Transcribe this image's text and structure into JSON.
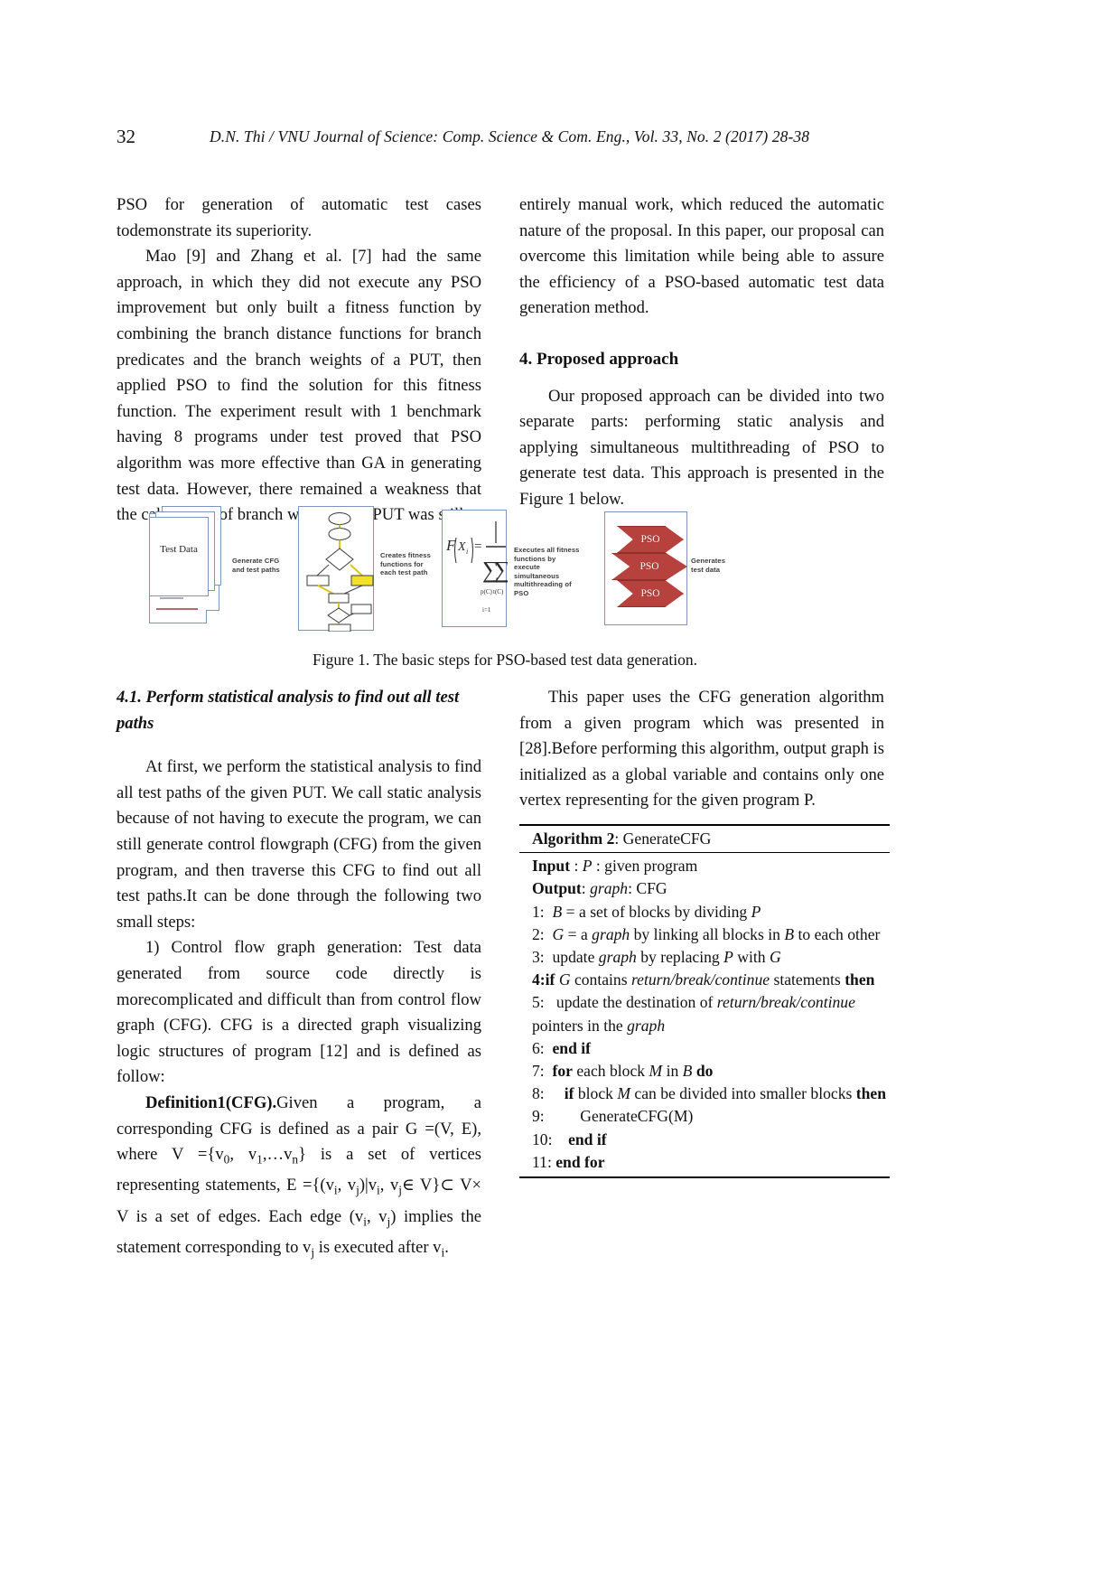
{
  "header": {
    "folio": "32",
    "running_title": "D.N. Thi / VNU Journal of Science: Comp. Science & Com. Eng., Vol. 33, No. 2 (2017) 28-38"
  },
  "left_column": {
    "para1": "PSO for generation of automatic test cases todemonstrate its superiority.",
    "para2": "Mao [9] and Zhang et al. [7] had the same approach, in which they did not execute any PSO improvement but only built a fitness function by combining the branch distance functions for branch predicates and the branch weights of a PUT, then applied PSO to find the solution for this fitness function. The experiment result with 1 benchmark having 8 programs under test proved that PSO algorithm was more effective than GA in generating test data. However, there remained a weakness that the calculation of branch weight for a PUT was still",
    "subsection_heading": "4.1. Perform statistical analysis to find out all test paths",
    "para3": "At first, we perform the statistical analysis to find all test paths of the given PUT. We call static analysis because of not having to execute the program, we can still generate control flowgraph (CFG) from the given program, and then traverse this CFG to find out all test paths.It can be done through the following two small steps:",
    "para4_prefix": "1) Control flow graph generation: Test data generated from source code directly is morecomplicated and difficult than from control flow graph (CFG). CFG is a directed graph visualizing logic structures of program [12] and is defined as follow:",
    "definition_label": "Definition1(CFG).",
    "definition_text_parts": {
      "t1": "Given a program, a corresponding CFG is defined as a pair G =(V, E), where V ={v",
      "s1": "0",
      "t2": ", v",
      "s2": "1",
      "t3": ",…v",
      "s3": "n",
      "t4": "} is a set of vertices representing statements, E ={(v",
      "s4": "i",
      "t5": ", v",
      "s5": "j",
      "t6": ")|v",
      "s6": "i",
      "t7": ", v",
      "s7": "j",
      "t8": "∈ V}⊂ V× V is a set of edges. Each edge (v",
      "s8": "i",
      "t9": ", v",
      "s9": "j",
      "t10": ") implies the statement corresponding to v",
      "s10": "j",
      "t11": " is executed after v",
      "s11": "i",
      "t12": "."
    }
  },
  "right_column": {
    "para1": "entirely manual work, which reduced the automatic nature of the proposal. In this paper, our proposal can overcome this limitation while being able to assure the efficiency of a PSO-based automatic test data generation method.",
    "section_heading": "4. Proposed approach",
    "para2": "Our proposed approach can be divided into two separate parts: performing static analysis and applying simultaneous multithreading of PSO to generate test data. This approach is presented in the Figure 1 below.",
    "para3": "This paper uses the CFG generation algorithm from a given program which was presented in [28].Before performing this algorithm, output graph is initialized as a global variable and contains only one vertex representing for the given program P."
  },
  "figure": {
    "caption": "Figure 1. The basic steps for PSO-based test data generation.",
    "labels": {
      "generate_cfg": "Generate CFG and test paths",
      "creates_fitness": "Creates fitness functions for each test path",
      "executes_all": "Executes all fitness functions by execute simultaneous multithreading of PSO",
      "generates_test_data": "Generates test data"
    },
    "pso_chevrons": [
      "PSO",
      "PSO",
      "PSO"
    ],
    "test_data_label": "Test Data",
    "colors": {
      "box_border": "#7e96be",
      "chevron_fill": "#b7413c",
      "chevron_stroke": "#8e2f2b",
      "cfg_highlight": "#f2e02a"
    }
  },
  "algorithm": {
    "title_bold": "Algorithm 2",
    "title_rest": ": GenerateCFG",
    "lines": [
      {
        "bold": "Input",
        "rest": " : ",
        "ital": "P",
        "tail": " : given program"
      },
      {
        "bold": "Output",
        "rest": ": ",
        "ital": "graph",
        "tail": ": CFG"
      }
    ],
    "steps": [
      "1:  B = a set of blocks by dividing P",
      "2:  G = a graph by linking all blocks in B to each other",
      "3:  update graph by replacing P with G",
      "4:if G contains return/break/continue statements then",
      "5:   update the destination of return/break/continue pointers in the graph",
      "6:  end if",
      "7:  for each block M in B do",
      "8:     if block M can be divided into smaller blocks then",
      "9:         GenerateCFG(M)",
      "10:    end if",
      "11: end for"
    ]
  }
}
